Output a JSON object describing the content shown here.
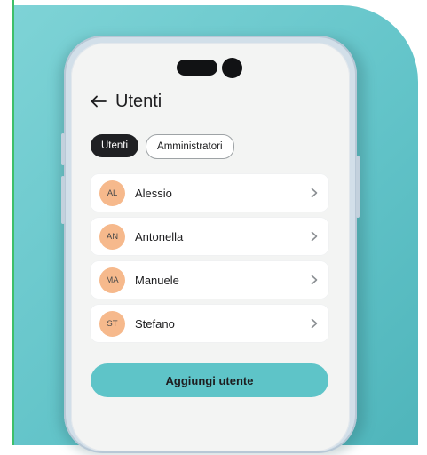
{
  "colors": {
    "accent_teal": "#5ec4c8",
    "avatar_bg": "#f6b98c",
    "tab_active_bg": "#1f2023",
    "screen_bg": "#f3f4f3",
    "card_bg": "#7ed3d6"
  },
  "header": {
    "back_icon": "arrow-left-icon",
    "title": "Utenti"
  },
  "tabs": [
    {
      "label": "Utenti",
      "active": true
    },
    {
      "label": "Amministratori",
      "active": false
    }
  ],
  "users": [
    {
      "initials": "AL",
      "name": "Alessio"
    },
    {
      "initials": "AN",
      "name": "Antonella"
    },
    {
      "initials": "MA",
      "name": "Manuele"
    },
    {
      "initials": "ST",
      "name": "Stefano"
    }
  ],
  "row_icon": "chevron-right-icon",
  "actions": {
    "add_user_label": "Aggiungi utente"
  }
}
